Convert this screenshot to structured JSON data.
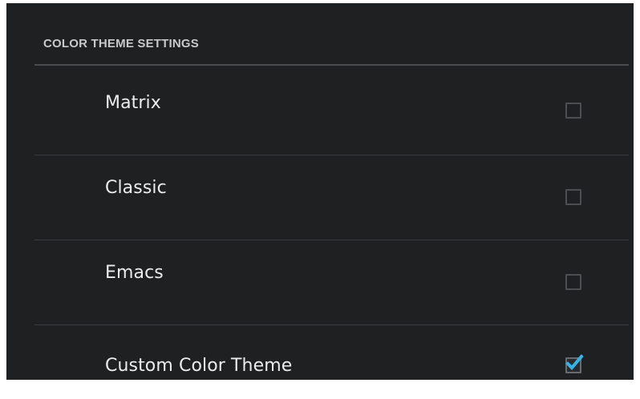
{
  "section": {
    "title": "COLOR THEME SETTINGS"
  },
  "themes": [
    {
      "label": "Matrix",
      "checked": false
    },
    {
      "label": "Classic",
      "checked": false
    },
    {
      "label": "Emacs",
      "checked": false
    },
    {
      "label": "Custom Color Theme",
      "checked": true
    }
  ],
  "colors": {
    "background": "#1f2022",
    "accent": "#33b5e5",
    "text": "#ececec",
    "header_text": "#c9c9c9",
    "divider": "#3b3c40"
  },
  "icons": {
    "checkbox_checked": "checkmark-icon"
  }
}
